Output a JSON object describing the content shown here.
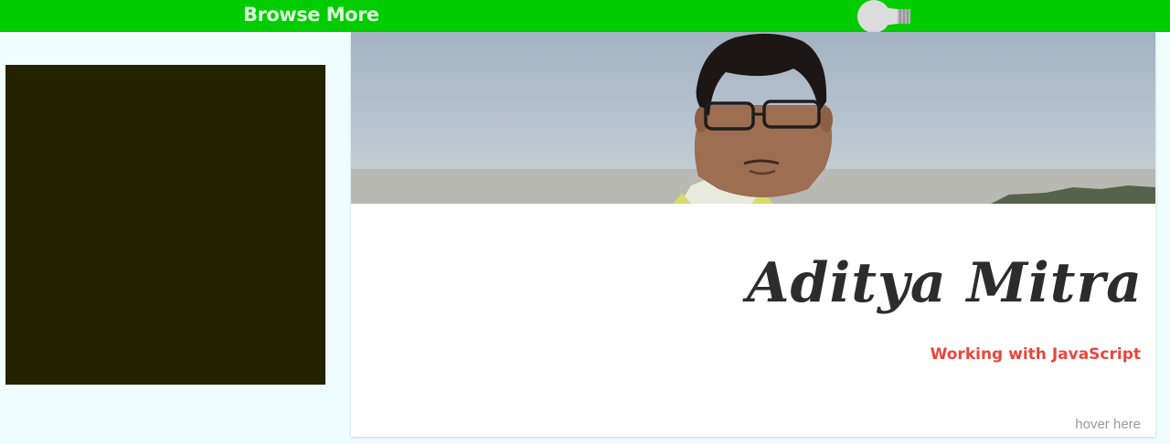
{
  "topbar": {
    "link_label": "Browse More",
    "icon": "lightbulb-icon",
    "background_color": "#00cc00"
  },
  "left_panel": {
    "color": "#232300"
  },
  "profile_card": {
    "photo_icon": "profile-photo",
    "name": "Aditya Mitra",
    "subtitle": "Working with JavaScript",
    "hint": "hover here",
    "name_color": "#2c2c2c",
    "subtitle_color": "#e8463e"
  }
}
